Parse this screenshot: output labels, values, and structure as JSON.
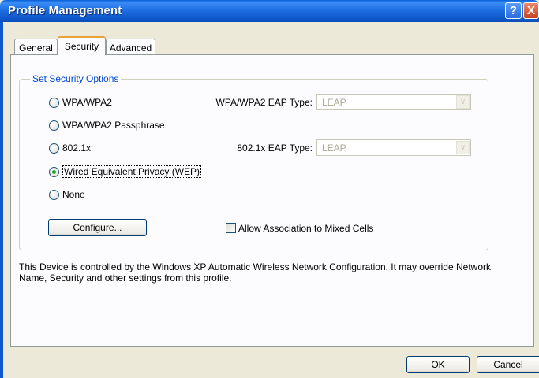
{
  "window": {
    "title": "Profile Management"
  },
  "titlebar": {
    "help_glyph": "?",
    "close_glyph": "X"
  },
  "tabs": [
    {
      "label": "General",
      "active": false
    },
    {
      "label": "Security",
      "active": true
    },
    {
      "label": "Advanced",
      "active": false
    }
  ],
  "security": {
    "group_title": "Set Security Options",
    "options": [
      {
        "label": "WPA/WPA2",
        "selected": false
      },
      {
        "label": "WPA/WPA2 Passphrase",
        "selected": false
      },
      {
        "label": "802.1x",
        "selected": false
      },
      {
        "label": "Wired Equivalent Privacy (WEP)",
        "selected": true
      },
      {
        "label": "None",
        "selected": false
      }
    ],
    "wpa_eap_label": "WPA/WPA2 EAP Type:",
    "wpa_eap_value": "LEAP",
    "dot1x_eap_label": "802.1x EAP Type:",
    "dot1x_eap_value": "LEAP",
    "configure_label": "Configure...",
    "mixed_cells_label": "Allow Association to Mixed Cells",
    "mixed_cells_checked": false
  },
  "info_text": "This Device is controlled by the Windows XP Automatic Wireless Network Configuration. It may override Network Name, Security and other settings from this profile.",
  "footer": {
    "ok_label": "OK",
    "cancel_label": "Cancel"
  },
  "colors": {
    "titlebar": "#1f6fe3",
    "dialog_bg": "#ece9d8",
    "group_title": "#0046d5",
    "selected_radio": "#21a121"
  }
}
